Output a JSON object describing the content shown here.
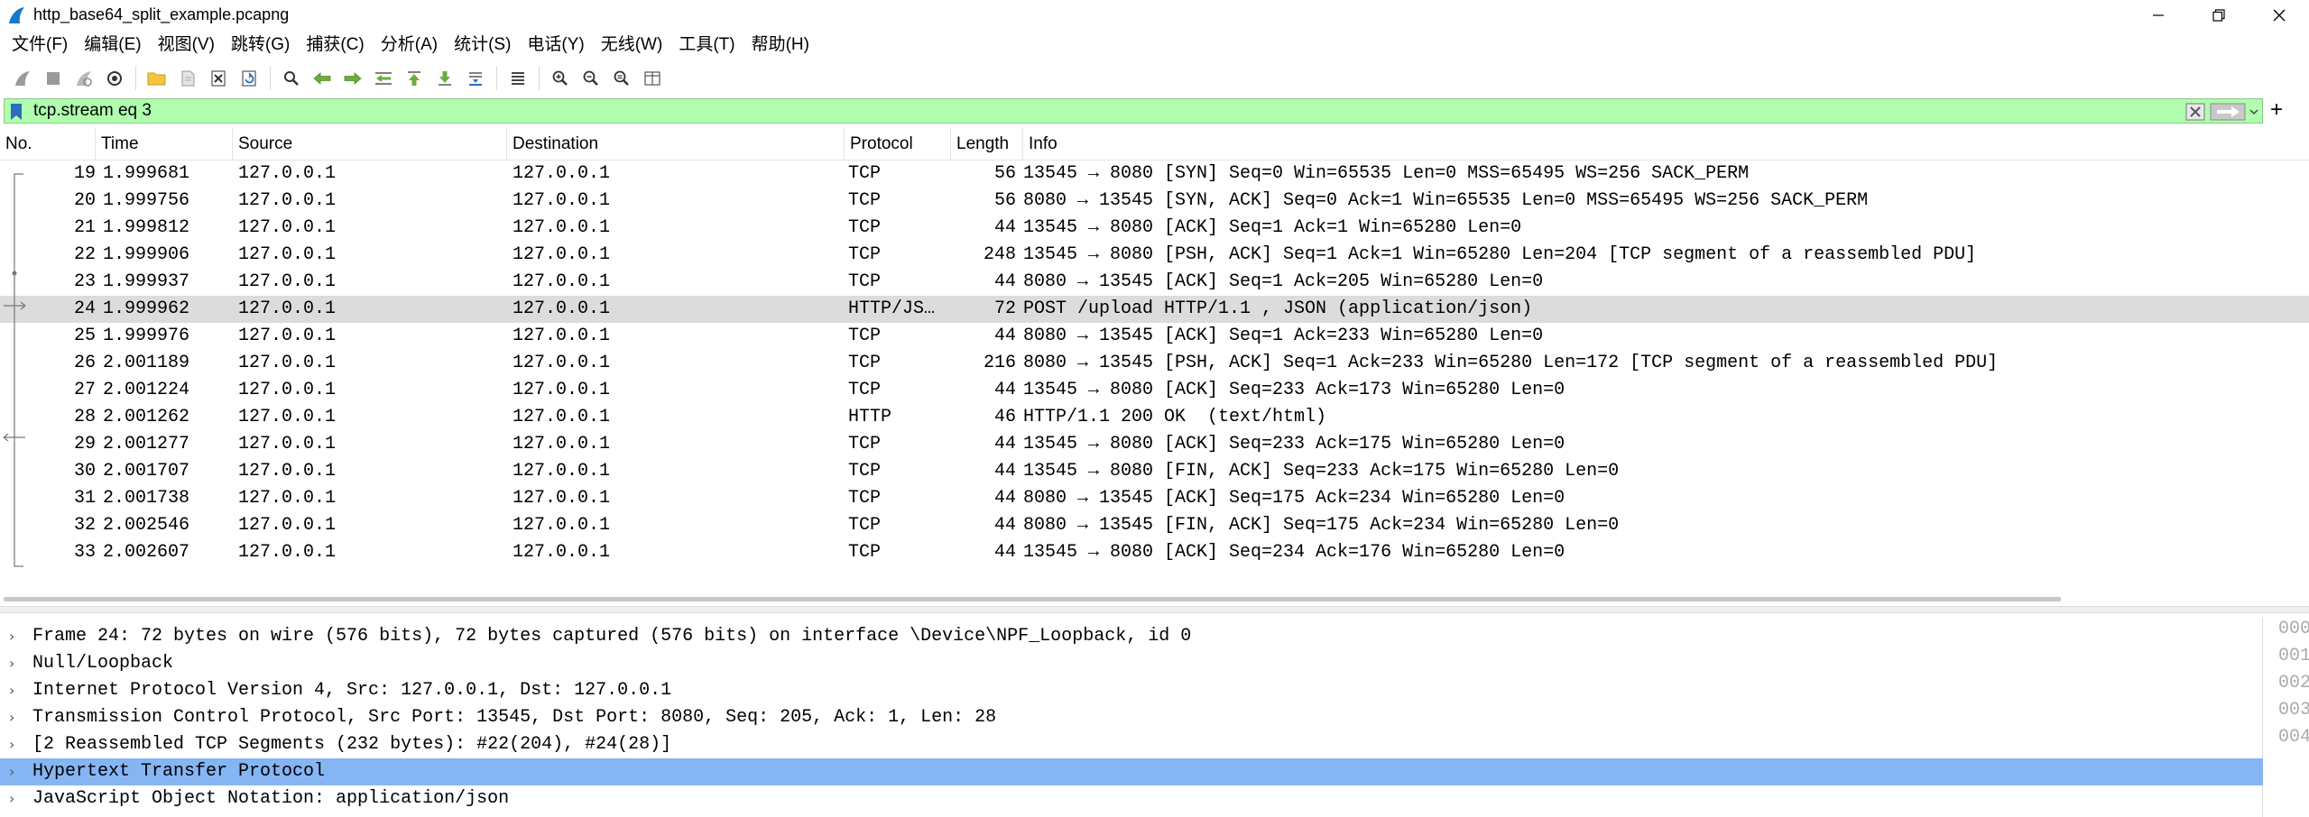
{
  "window": {
    "title": "http_base64_split_example.pcapng"
  },
  "menu": [
    "文件(F)",
    "编辑(E)",
    "视图(V)",
    "跳转(G)",
    "捕获(C)",
    "分析(A)",
    "统计(S)",
    "电话(Y)",
    "无线(W)",
    "工具(T)",
    "帮助(H)"
  ],
  "toolbar_icons": [
    "start-capture-icon",
    "stop-capture-icon",
    "restart-capture-icon",
    "capture-options-icon",
    "open-file-icon",
    "save-file-icon",
    "close-file-icon",
    "reload-file-icon",
    "find-packet-icon",
    "go-back-icon",
    "go-forward-icon",
    "go-to-packet-icon",
    "go-first-icon",
    "go-last-icon",
    "autoscroll-icon",
    "colorize-icon",
    "zoom-in-icon",
    "zoom-out-icon",
    "normal-size-icon",
    "resize-columns-icon"
  ],
  "filter": {
    "value": "tcp.stream eq 3"
  },
  "packet_list": {
    "columns": [
      "No.",
      "Time",
      "Source",
      "Destination",
      "Protocol",
      "Length",
      "Info"
    ],
    "rows": [
      {
        "no": "19",
        "time": "1.999681",
        "src": "127.0.0.1",
        "dst": "127.0.0.1",
        "proto": "TCP",
        "len": "56",
        "info": "13545 → 8080 [SYN] Seq=0 Win=65535 Len=0 MSS=65495 WS=256 SACK_PERM"
      },
      {
        "no": "20",
        "time": "1.999756",
        "src": "127.0.0.1",
        "dst": "127.0.0.1",
        "proto": "TCP",
        "len": "56",
        "info": "8080 → 13545 [SYN, ACK] Seq=0 Ack=1 Win=65535 Len=0 MSS=65495 WS=256 SACK_PERM"
      },
      {
        "no": "21",
        "time": "1.999812",
        "src": "127.0.0.1",
        "dst": "127.0.0.1",
        "proto": "TCP",
        "len": "44",
        "info": "13545 → 8080 [ACK] Seq=1 Ack=1 Win=65280 Len=0"
      },
      {
        "no": "22",
        "time": "1.999906",
        "src": "127.0.0.1",
        "dst": "127.0.0.1",
        "proto": "TCP",
        "len": "248",
        "info": "13545 → 8080 [PSH, ACK] Seq=1 Ack=1 Win=65280 Len=204 [TCP segment of a reassembled PDU]"
      },
      {
        "no": "23",
        "time": "1.999937",
        "src": "127.0.0.1",
        "dst": "127.0.0.1",
        "proto": "TCP",
        "len": "44",
        "info": "8080 → 13545 [ACK] Seq=1 Ack=205 Win=65280 Len=0"
      },
      {
        "no": "24",
        "time": "1.999962",
        "src": "127.0.0.1",
        "dst": "127.0.0.1",
        "proto": "HTTP/JS…",
        "len": "72",
        "info": "POST /upload HTTP/1.1 , JSON (application/json)",
        "selected": true
      },
      {
        "no": "25",
        "time": "1.999976",
        "src": "127.0.0.1",
        "dst": "127.0.0.1",
        "proto": "TCP",
        "len": "44",
        "info": "8080 → 13545 [ACK] Seq=1 Ack=233 Win=65280 Len=0"
      },
      {
        "no": "26",
        "time": "2.001189",
        "src": "127.0.0.1",
        "dst": "127.0.0.1",
        "proto": "TCP",
        "len": "216",
        "info": "8080 → 13545 [PSH, ACK] Seq=1 Ack=233 Win=65280 Len=172 [TCP segment of a reassembled PDU]"
      },
      {
        "no": "27",
        "time": "2.001224",
        "src": "127.0.0.1",
        "dst": "127.0.0.1",
        "proto": "TCP",
        "len": "44",
        "info": "13545 → 8080 [ACK] Seq=233 Ack=173 Win=65280 Len=0"
      },
      {
        "no": "28",
        "time": "2.001262",
        "src": "127.0.0.1",
        "dst": "127.0.0.1",
        "proto": "HTTP",
        "len": "46",
        "info": "HTTP/1.1 200 OK  (text/html)"
      },
      {
        "no": "29",
        "time": "2.001277",
        "src": "127.0.0.1",
        "dst": "127.0.0.1",
        "proto": "TCP",
        "len": "44",
        "info": "13545 → 8080 [ACK] Seq=233 Ack=175 Win=65280 Len=0"
      },
      {
        "no": "30",
        "time": "2.001707",
        "src": "127.0.0.1",
        "dst": "127.0.0.1",
        "proto": "TCP",
        "len": "44",
        "info": "13545 → 8080 [FIN, ACK] Seq=233 Ack=175 Win=65280 Len=0"
      },
      {
        "no": "31",
        "time": "2.001738",
        "src": "127.0.0.1",
        "dst": "127.0.0.1",
        "proto": "TCP",
        "len": "44",
        "info": "8080 → 13545 [ACK] Seq=175 Ack=234 Win=65280 Len=0"
      },
      {
        "no": "32",
        "time": "2.002546",
        "src": "127.0.0.1",
        "dst": "127.0.0.1",
        "proto": "TCP",
        "len": "44",
        "info": "8080 → 13545 [FIN, ACK] Seq=175 Ack=234 Win=65280 Len=0"
      },
      {
        "no": "33",
        "time": "2.002607",
        "src": "127.0.0.1",
        "dst": "127.0.0.1",
        "proto": "TCP",
        "len": "44",
        "info": "13545 → 8080 [ACK] Seq=234 Ack=176 Win=65280 Len=0"
      }
    ]
  },
  "details": {
    "rows": [
      {
        "text": "Frame 24: 72 bytes on wire (576 bits), 72 bytes captured (576 bits) on interface \\Device\\NPF_Loopback, id 0"
      },
      {
        "text": "Null/Loopback"
      },
      {
        "text": "Internet Protocol Version 4, Src: 127.0.0.1, Dst: 127.0.0.1"
      },
      {
        "text": "Transmission Control Protocol, Src Port: 13545, Dst Port: 8080, Seq: 205, Ack: 1, Len: 28"
      },
      {
        "text": "[2 Reassembled TCP Segments (232 bytes): #22(204), #24(28)]"
      },
      {
        "text": "Hypertext Transfer Protocol",
        "selected": true
      },
      {
        "text": "JavaScript Object Notation: application/json"
      }
    ]
  },
  "bytes": {
    "offsets": [
      "000",
      "001",
      "002",
      "003",
      "004"
    ]
  },
  "colors": {
    "filter_valid": "#afffaf",
    "selected_packet": "#dcdcdc",
    "selected_detail": "#86b5f3"
  }
}
